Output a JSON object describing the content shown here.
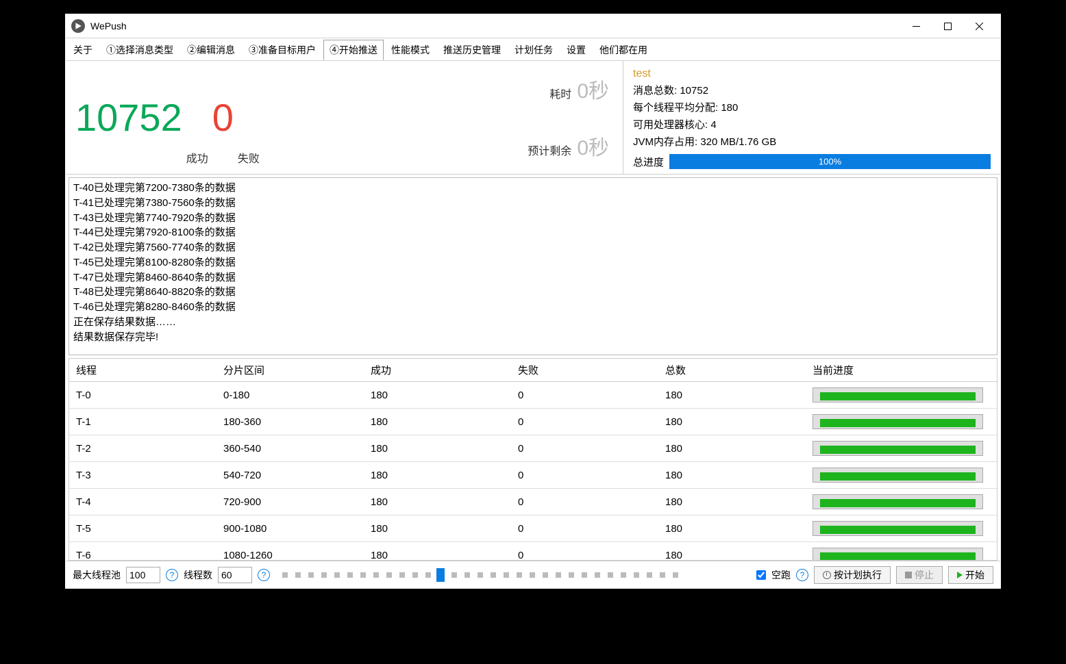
{
  "window": {
    "title": "WePush"
  },
  "tabs": [
    "关于",
    "①选择消息类型",
    "②编辑消息",
    "③准备目标用户",
    "④开始推送",
    "性能模式",
    "推送历史管理",
    "计划任务",
    "设置",
    "他们都在用"
  ],
  "active_tab": 4,
  "stats": {
    "success_count": "10752",
    "success_label": "成功",
    "fail_count": "0",
    "fail_label": "失败",
    "elapsed_label": "耗时",
    "elapsed_value": "0秒",
    "eta_label": "预计剩余",
    "eta_value": "0秒"
  },
  "info": {
    "test_label": "test",
    "total_label": "消息总数:",
    "total_value": "10752",
    "avg_label": "每个线程平均分配:",
    "avg_value": "180",
    "cores_label": "可用处理器核心:",
    "cores_value": "4",
    "jvm_label": "JVM内存占用:",
    "jvm_value": "320 MB/1.76 GB",
    "overall_label": "总进度",
    "overall_pct": "100%"
  },
  "log": [
    "T-40已处理完第7200-7380条的数据",
    "T-41已处理完第7380-7560条的数据",
    "T-43已处理完第7740-7920条的数据",
    "T-44已处理完第7920-8100条的数据",
    "T-42已处理完第7560-7740条的数据",
    "T-45已处理完第8100-8280条的数据",
    "T-47已处理完第8460-8640条的数据",
    "T-48已处理完第8640-8820条的数据",
    "T-46已处理完第8280-8460条的数据",
    "正在保存结果数据……",
    "结果数据保存完毕!"
  ],
  "table": {
    "headers": {
      "thread": "线程",
      "range": "分片区间",
      "success": "成功",
      "fail": "失败",
      "total": "总数",
      "progress": "当前进度"
    },
    "rows": [
      {
        "thread": "T-0",
        "range": "0-180",
        "success": "180",
        "fail": "0",
        "total": "180"
      },
      {
        "thread": "T-1",
        "range": "180-360",
        "success": "180",
        "fail": "0",
        "total": "180"
      },
      {
        "thread": "T-2",
        "range": "360-540",
        "success": "180",
        "fail": "0",
        "total": "180"
      },
      {
        "thread": "T-3",
        "range": "540-720",
        "success": "180",
        "fail": "0",
        "total": "180"
      },
      {
        "thread": "T-4",
        "range": "720-900",
        "success": "180",
        "fail": "0",
        "total": "180"
      },
      {
        "thread": "T-5",
        "range": "900-1080",
        "success": "180",
        "fail": "0",
        "total": "180"
      },
      {
        "thread": "T-6",
        "range": "1080-1260",
        "success": "180",
        "fail": "0",
        "total": "180"
      }
    ]
  },
  "footer": {
    "pool_label": "最大线程池",
    "pool_value": "100",
    "threads_label": "线程数",
    "threads_value": "60",
    "dryrun_label": "空跑",
    "schedule_btn": "按计划执行",
    "stop_btn": "停止",
    "start_btn": "开始"
  }
}
